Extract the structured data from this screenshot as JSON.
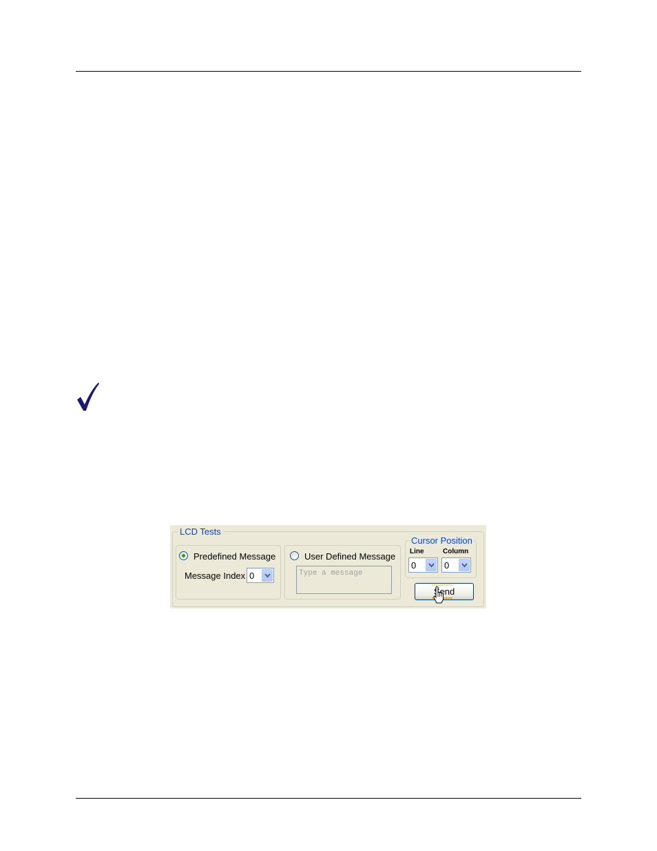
{
  "lcd_tests": {
    "title": "LCD Tests",
    "predefined": {
      "label": "Predefined Message",
      "selected": true,
      "index_label": "Message Index",
      "index_value": "0"
    },
    "user_defined": {
      "label": "User Defined Message",
      "selected": false,
      "placeholder": "Type a message"
    },
    "cursor_position": {
      "title": "Cursor Position",
      "line_label": "Line",
      "line_value": "0",
      "column_label": "Column",
      "column_value": "0"
    },
    "send_label": "Send"
  },
  "colors": {
    "legend": "#0046d5",
    "panel_bg": "#ece9d8",
    "radio_dot": "#21a121",
    "checkmark": "#1a1a6e"
  },
  "icons": [
    "checkmark-icon",
    "chevron-down-icon",
    "hand-pointer-icon"
  ]
}
